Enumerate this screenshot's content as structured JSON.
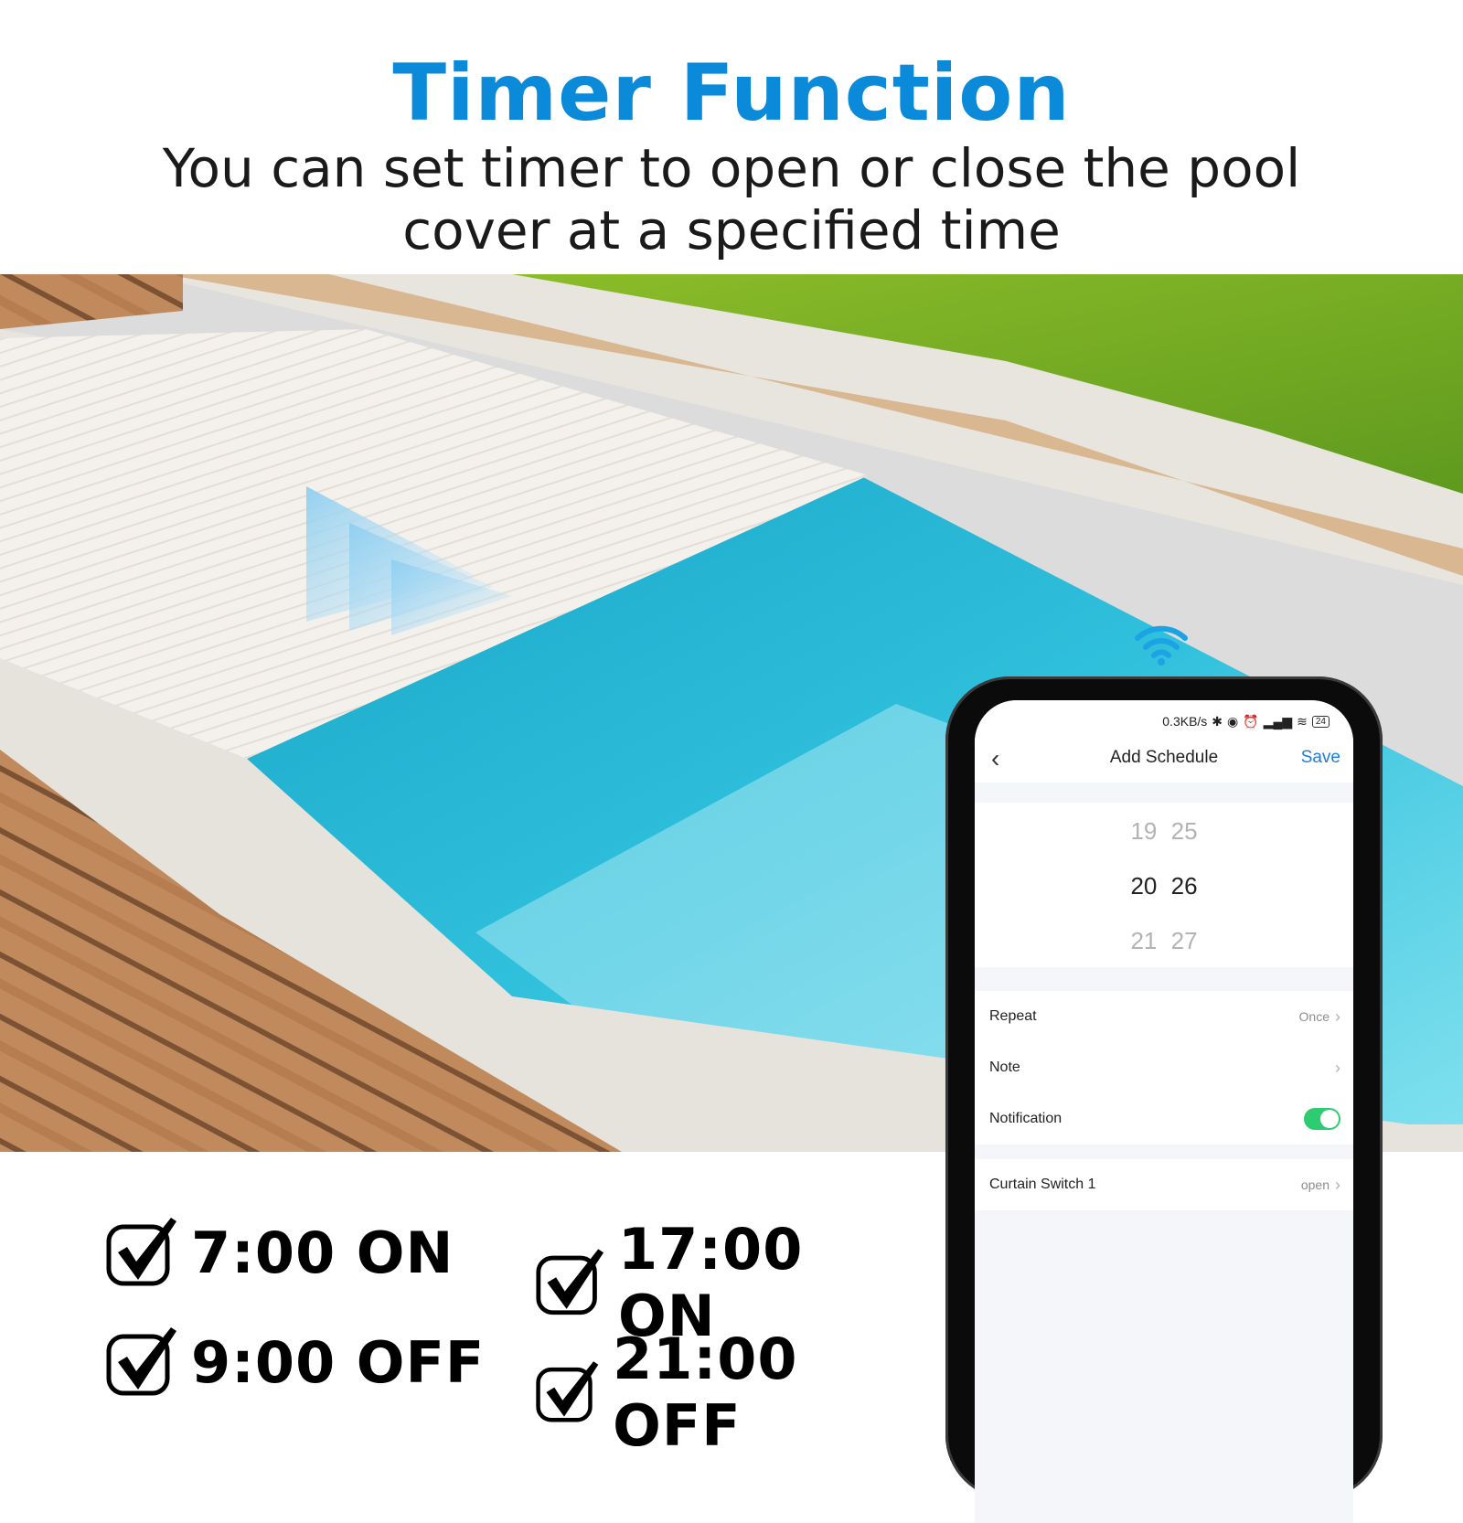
{
  "header": {
    "title": "Timer Function",
    "subtitle_line1": "You can set timer to open or close the pool",
    "subtitle_line2": "cover at a specified time",
    "accent_color": "#0a8ad8"
  },
  "schedules": [
    {
      "label": "7:00 ON",
      "icon": "checkbox-checked-icon"
    },
    {
      "label": "9:00 OFF",
      "icon": "checkbox-checked-icon"
    },
    {
      "label": "17:00 ON",
      "icon": "checkbox-checked-icon"
    },
    {
      "label": "21:00 OFF",
      "icon": "checkbox-checked-icon"
    }
  ],
  "phone": {
    "statusbar": {
      "speed": "0.3KB/s",
      "icons": [
        "bluetooth-icon",
        "vibrate-icon",
        "alarm-icon",
        "signal-icon",
        "wifi-icon",
        "battery-icon"
      ],
      "battery": "24"
    },
    "navbar": {
      "back_icon": "chevron-left-icon",
      "title": "Add Schedule",
      "save_label": "Save",
      "save_color": "#1c7ddc"
    },
    "time_picker": {
      "prev": {
        "hour": "19",
        "minute": "25"
      },
      "selected": {
        "hour": "20",
        "minute": "26"
      },
      "next": {
        "hour": "21",
        "minute": "27"
      }
    },
    "settings": [
      {
        "label": "Repeat",
        "value": "Once"
      },
      {
        "label": "Note",
        "value": ""
      },
      {
        "label": "Notification",
        "toggle_on": true
      }
    ],
    "action": {
      "label": "Curtain Switch 1",
      "value": "open"
    },
    "toggle_color": "#2ecc71"
  }
}
